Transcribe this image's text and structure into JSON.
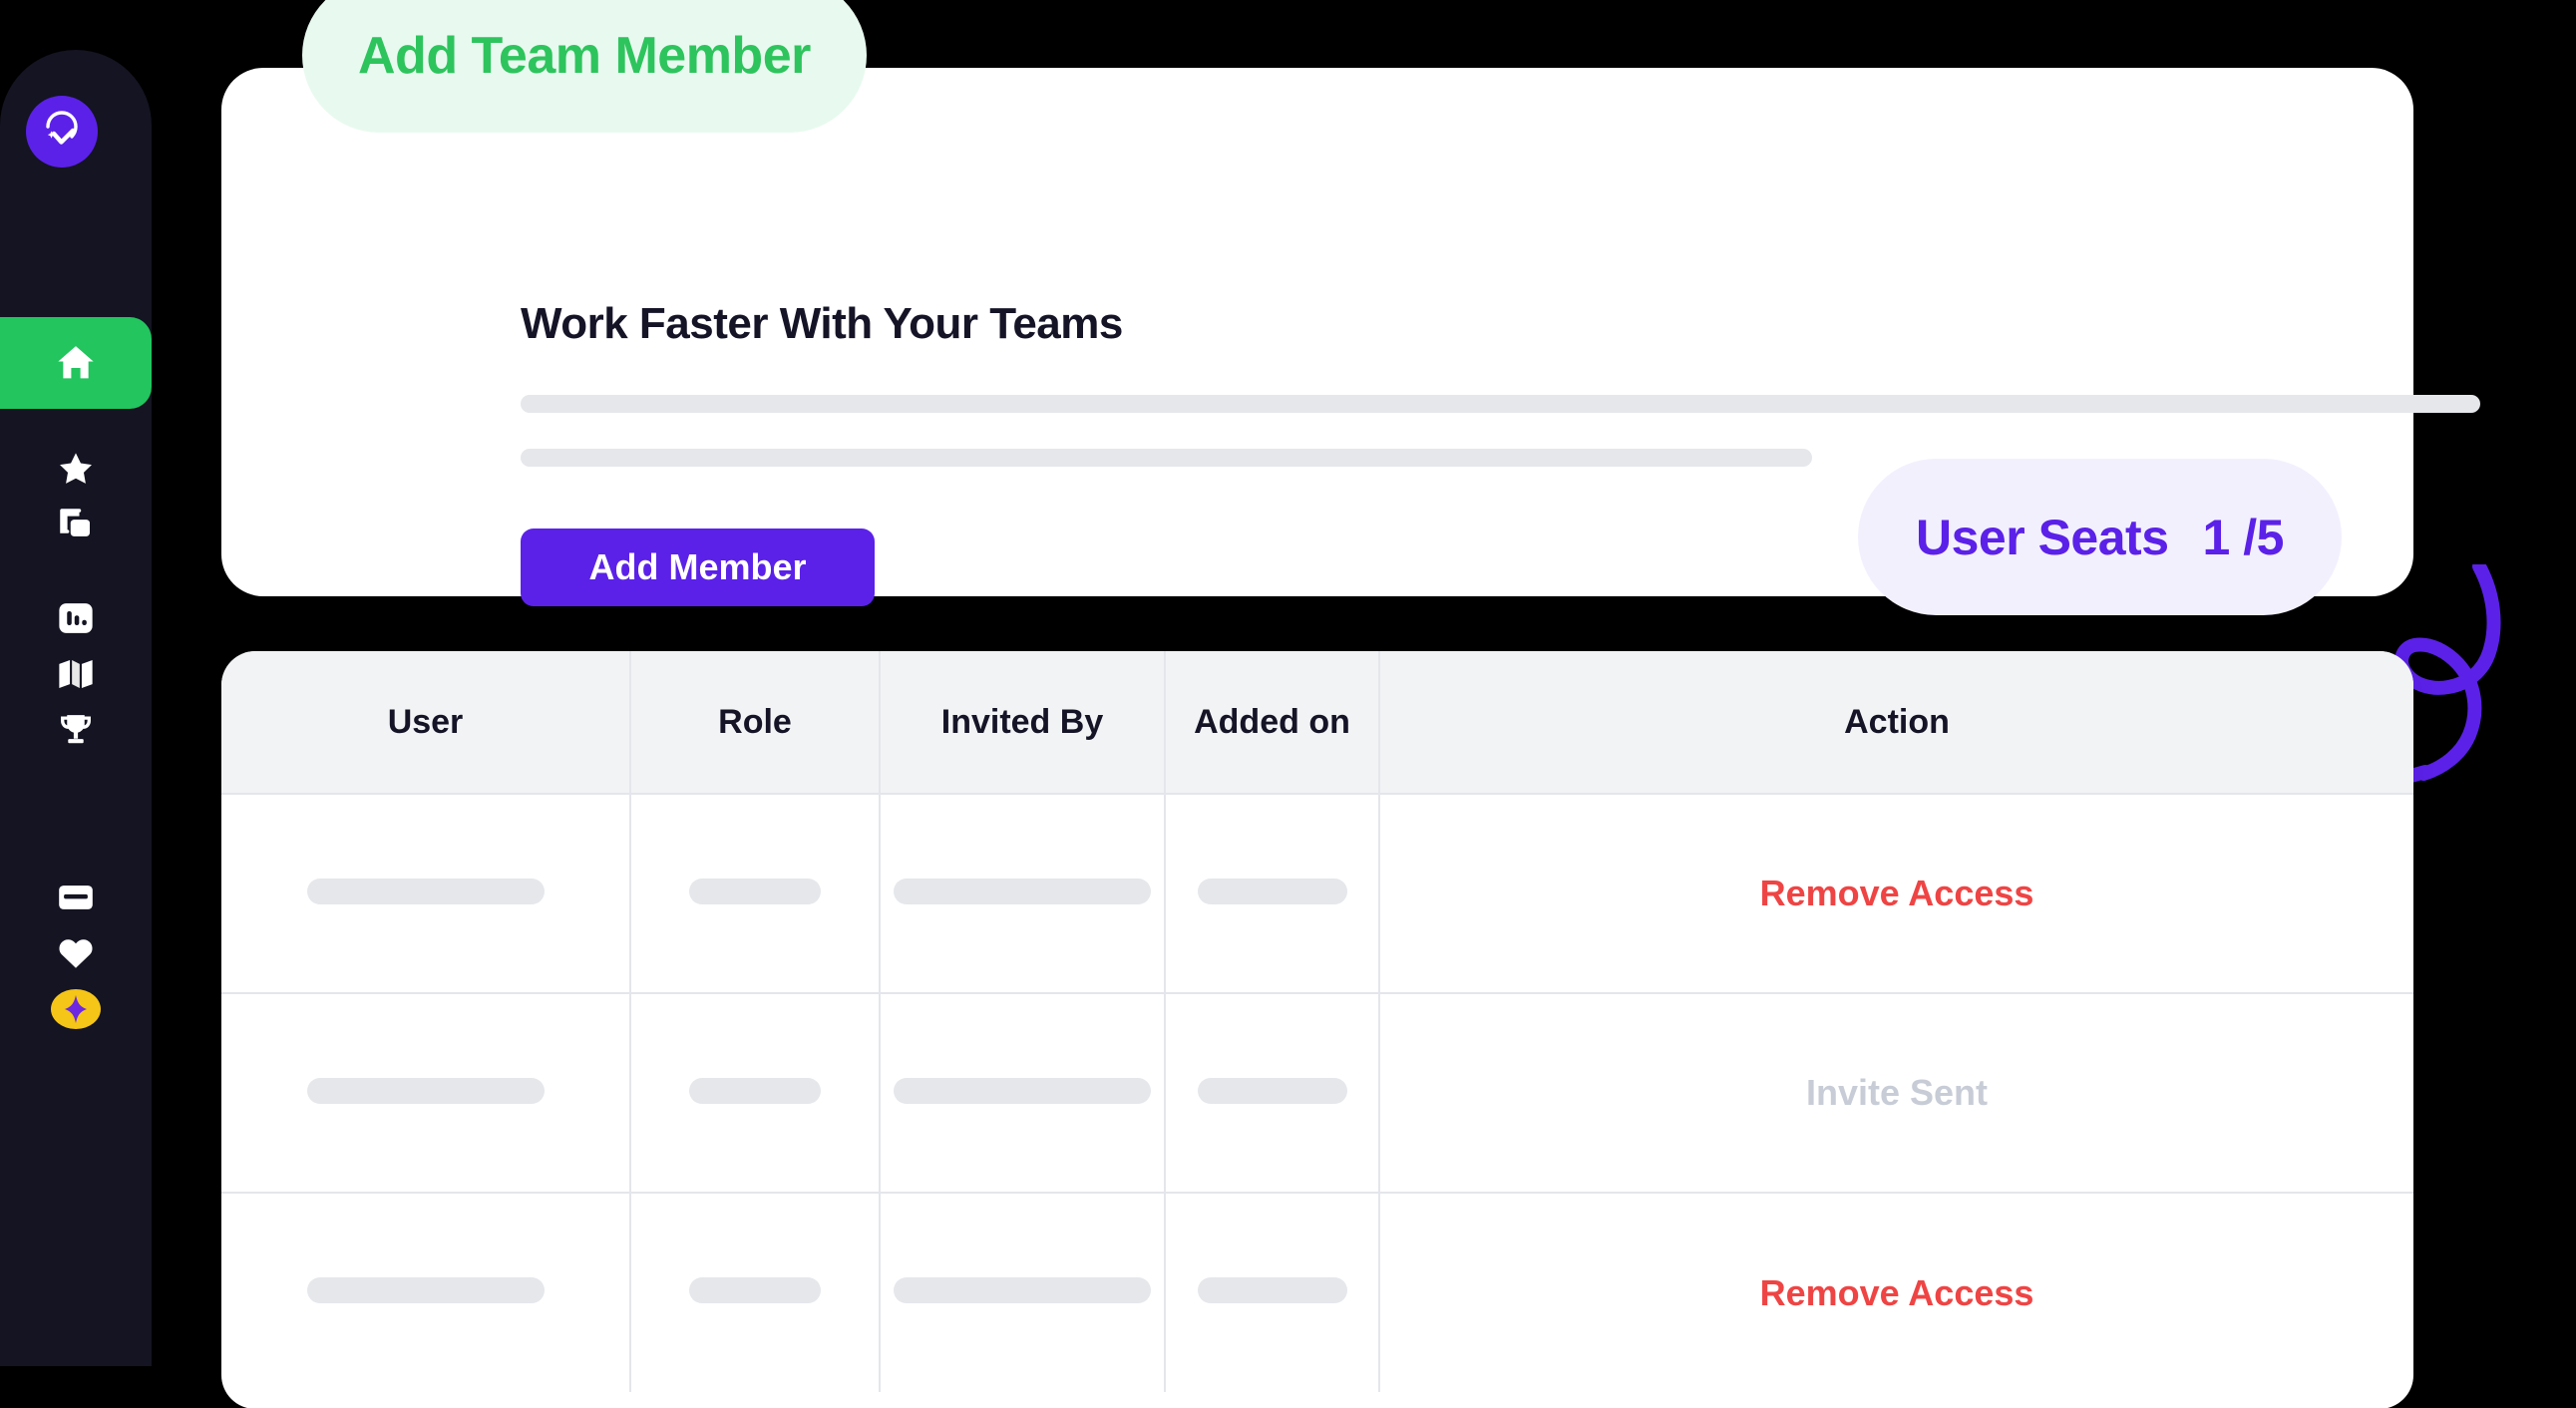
{
  "sidebar": {
    "logo_icon": "location-pin-check-logo",
    "items": [
      {
        "icon": "home-icon",
        "name": "home",
        "active": true
      },
      {
        "icon": "star-icon",
        "name": "favorites",
        "active": false
      },
      {
        "icon": "copy-icon",
        "name": "duplicate",
        "active": false
      },
      {
        "icon": "bar-chart-icon",
        "name": "analytics",
        "active": false
      },
      {
        "icon": "map-icon",
        "name": "map",
        "active": false
      },
      {
        "icon": "trophy-icon",
        "name": "achievements",
        "active": false
      },
      {
        "icon": "credit-card-icon",
        "name": "billing",
        "active": false
      },
      {
        "icon": "heart-icon",
        "name": "saved",
        "active": false
      },
      {
        "icon": "sparkle-icon",
        "name": "premium",
        "active": false
      }
    ]
  },
  "badge": {
    "label": "Add Team Member"
  },
  "card": {
    "title": "Work Faster With Your Teams",
    "add_member_label": "Add Member",
    "skeleton_lines": 2
  },
  "seats": {
    "label": "User Seats",
    "value": "1 /5",
    "used": 1,
    "total": 5
  },
  "table": {
    "columns": [
      "User",
      "Role",
      "Invited By",
      "Added on",
      "Action"
    ],
    "rows": [
      {
        "user": "",
        "role": "",
        "invited_by": "",
        "added_on": "",
        "action": "Remove Access",
        "action_state": "remove"
      },
      {
        "user": "",
        "role": "",
        "invited_by": "",
        "added_on": "",
        "action": "Invite Sent",
        "action_state": "sent"
      },
      {
        "user": "",
        "role": "",
        "invited_by": "",
        "added_on": "",
        "action": "Remove Access",
        "action_state": "remove"
      }
    ]
  },
  "colors": {
    "background": "#000000",
    "sidebar": "#141422",
    "accent_purple": "#5B21E8",
    "accent_green": "#22C55E",
    "badge_green_bg": "#E8FAEF",
    "badge_green_text": "#2EC45D",
    "seats_badge_bg": "#F3F0FE",
    "danger_red": "#EF4444",
    "muted_gray": "#C7CCD6",
    "skeleton": "#E5E7EB",
    "table_header_bg": "#F2F3F5",
    "border": "#E4E6EB",
    "sparkle_gold": "#F5C518"
  },
  "arrow": {
    "name": "curved-loop-arrow",
    "color": "#5B21E8",
    "direction": "down-left"
  }
}
